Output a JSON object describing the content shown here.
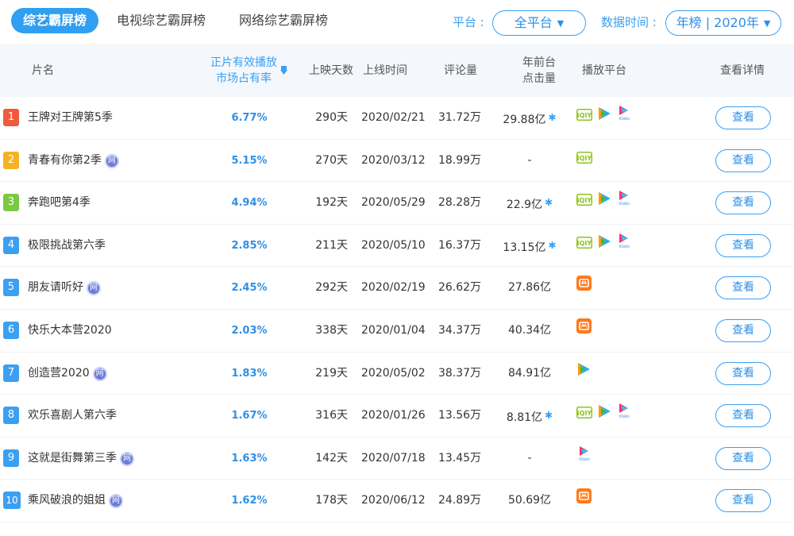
{
  "tabs": [
    {
      "label": "综艺霸屏榜",
      "active": true
    },
    {
      "label": "电视综艺霸屏榜",
      "active": false
    },
    {
      "label": "网络综艺霸屏榜",
      "active": false
    }
  ],
  "filters": {
    "platform_label": "平台 :",
    "platform_value": "全平台",
    "time_label": "数据时间 :",
    "time_value": "年榜 | 2020年"
  },
  "columns": {
    "title": "片名",
    "share_line1": "正片有效播放",
    "share_line2": "市场占有率",
    "days": "上映天数",
    "date": "上线时间",
    "comments": "评论量",
    "clicks_line1": "年前台",
    "clicks_line2": "点击量",
    "platforms": "播放平台",
    "details": "查看详情"
  },
  "colors": {
    "accent": "#2f9ff1",
    "rank1": "#f05a3c",
    "rank2": "#f5b223",
    "rank3": "#7ac943",
    "rank_other": "#3b9ff2"
  },
  "network_badge": "网",
  "detail_label": "查看",
  "rows": [
    {
      "rank": "1",
      "title": "王牌对王牌第5季",
      "net": false,
      "share": "6.77%",
      "days": "290天",
      "date": "2020/02/21",
      "comments": "31.72万",
      "clicks": "29.88亿",
      "star": true,
      "platforms": [
        "iqiyi-icon",
        "tencent-video-icon",
        "youku-icon"
      ]
    },
    {
      "rank": "2",
      "title": "青春有你第2季",
      "net": true,
      "share": "5.15%",
      "days": "270天",
      "date": "2020/03/12",
      "comments": "18.99万",
      "clicks": "-",
      "star": false,
      "platforms": [
        "iqiyi-icon"
      ]
    },
    {
      "rank": "3",
      "title": "奔跑吧第4季",
      "net": false,
      "share": "4.94%",
      "days": "192天",
      "date": "2020/05/29",
      "comments": "28.28万",
      "clicks": "22.9亿",
      "star": true,
      "platforms": [
        "iqiyi-icon",
        "tencent-video-icon",
        "youku-icon"
      ]
    },
    {
      "rank": "4",
      "title": "极限挑战第六季",
      "net": false,
      "share": "2.85%",
      "days": "211天",
      "date": "2020/05/10",
      "comments": "16.37万",
      "clicks": "13.15亿",
      "star": true,
      "platforms": [
        "iqiyi-icon",
        "tencent-video-icon",
        "youku-icon"
      ]
    },
    {
      "rank": "5",
      "title": "朋友请听好",
      "net": true,
      "share": "2.45%",
      "days": "292天",
      "date": "2020/02/19",
      "comments": "26.62万",
      "clicks": "27.86亿",
      "star": false,
      "platforms": [
        "mango-tv-icon"
      ]
    },
    {
      "rank": "6",
      "title": "快乐大本营2020",
      "net": false,
      "share": "2.03%",
      "days": "338天",
      "date": "2020/01/04",
      "comments": "34.37万",
      "clicks": "40.34亿",
      "star": false,
      "platforms": [
        "mango-tv-icon"
      ]
    },
    {
      "rank": "7",
      "title": "创造营2020",
      "net": true,
      "share": "1.83%",
      "days": "219天",
      "date": "2020/05/02",
      "comments": "38.37万",
      "clicks": "84.91亿",
      "star": false,
      "platforms": [
        "tencent-video-icon"
      ]
    },
    {
      "rank": "8",
      "title": "欢乐喜剧人第六季",
      "net": false,
      "share": "1.67%",
      "days": "316天",
      "date": "2020/01/26",
      "comments": "13.56万",
      "clicks": "8.81亿",
      "star": true,
      "platforms": [
        "iqiyi-icon",
        "tencent-video-icon",
        "youku-icon"
      ]
    },
    {
      "rank": "9",
      "title": "这就是街舞第三季",
      "net": true,
      "share": "1.63%",
      "days": "142天",
      "date": "2020/07/18",
      "comments": "13.45万",
      "clicks": "-",
      "star": false,
      "platforms": [
        "youku-icon"
      ]
    },
    {
      "rank": "10",
      "title": "乘风破浪的姐姐",
      "net": true,
      "share": "1.62%",
      "days": "178天",
      "date": "2020/06/12",
      "comments": "24.89万",
      "clicks": "50.69亿",
      "star": false,
      "platforms": [
        "mango-tv-icon"
      ]
    }
  ]
}
